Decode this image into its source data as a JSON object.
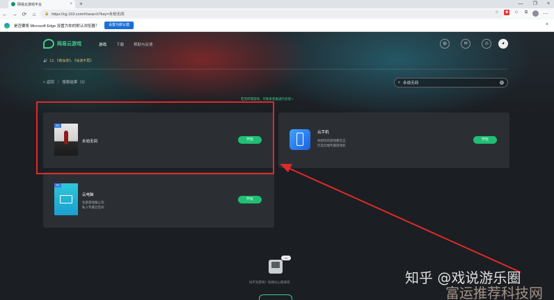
{
  "browser": {
    "tab_title": "网易云游戏平台",
    "tab_close": "×",
    "new_tab": "+",
    "window_controls": [
      "—",
      "❐",
      "×"
    ],
    "url": "https://cg.163.com/#/search?key=永劫无间",
    "infobar_text": "是否要将 Microsoft Edge 设置为你的默认浏览器？",
    "infobar_button": "设置为默认值",
    "infobar_close": "×"
  },
  "site": {
    "logo_text": "网易云游戏",
    "nav": [
      "游戏",
      "下载",
      "帮助与反馈"
    ],
    "notice": "13、《真仙传》、《仙侠不再》",
    "crumbs": {
      "back": "< 返回",
      "results": "搜索结果（3）"
    },
    "search_value": "永劫无间",
    "hint": "若无所需游戏，可联系客服进行反馈 >"
  },
  "results": [
    {
      "name": "永劫无间",
      "tag": "PC",
      "button": "开玩",
      "desc": ""
    },
    {
      "name": "云手机",
      "tag": "",
      "button": "开玩",
      "desc": [
        "你想玩的游戏都在这",
        "打造云端专属游戏机"
      ]
    },
    {
      "name": "云电脑",
      "tag": "PC",
      "button": "开玩",
      "desc": [
        "任意游戏随心玩",
        "私人专属云空间"
      ]
    }
  ],
  "empty": {
    "bubble": "•••",
    "text": "找不到游戏？快猜问心愿来吧"
  },
  "watermark": {
    "line1": "知乎 @戏说游乐圈",
    "line2": "富运推荐科技网"
  },
  "colors": {
    "accent": "#1fbf74",
    "annotation": "#e02a2a"
  }
}
